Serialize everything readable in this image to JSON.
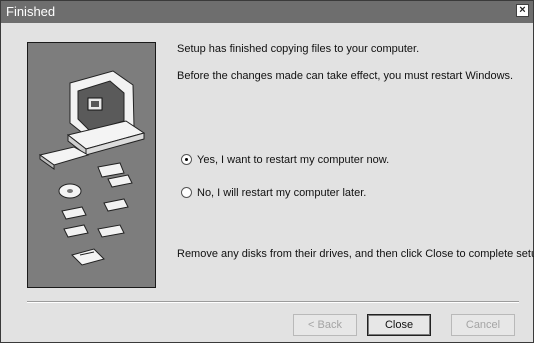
{
  "window": {
    "title": "Finished"
  },
  "content": {
    "line1": "Setup has finished copying files to your computer.",
    "line2": "Before the changes made can take effect, you must restart Windows.",
    "options": [
      {
        "label": "Yes, I want to restart my computer now.",
        "selected": true
      },
      {
        "label": "No, I will restart my computer later.",
        "selected": false
      }
    ],
    "instruction": "Remove any disks from their drives, and then click Close to complete setup."
  },
  "buttons": {
    "back": "< Back",
    "close": "Close",
    "cancel": "Cancel"
  }
}
